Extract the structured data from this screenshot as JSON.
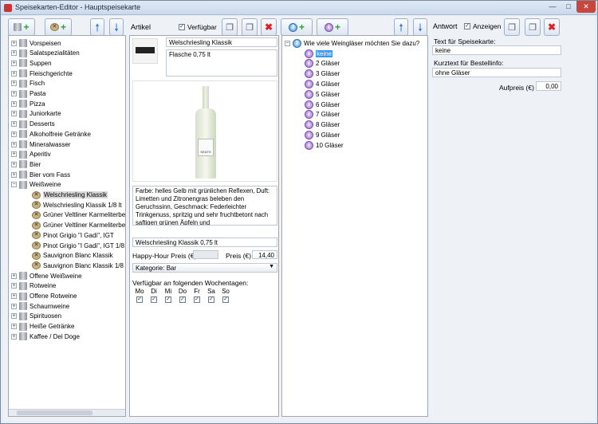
{
  "window": {
    "title": "Speisekarten-Editor - Hauptspeisekarte"
  },
  "toolbar": {
    "artikel_label": "Artikel",
    "verfuegbar_label": "Verfügbar",
    "antwort_label": "Antwort",
    "anzeigen_label": "Anzeigen"
  },
  "tree": {
    "categories_top": [
      "Vorspeisen",
      "Salatspezialitäten",
      "Suppen",
      "Fleischgerichte",
      "Fisch",
      "Pasta",
      "Pizza",
      "Juniorkarte",
      "Desserts",
      "Alkoholfreie Getränke",
      "Mineralwasser",
      "Aperitiv",
      "Bier",
      "Bier vom Fass",
      "Weißweine"
    ],
    "weissweine_items": [
      "Welschriesling Klassik",
      "Welschriesling Klassik 1/8 lt",
      "Grüner Veltliner Karmeliterber",
      "Grüner Veltliner Karmeliterber",
      "Pinot Grigio \"I Gadi\", IGT",
      "Pinot Grigio \"I Gadi\", IGT 1/8 lt",
      "Sauvignon Blanc Klassik",
      "Sauvignon Blanc Klassik 1/8 lt"
    ],
    "categories_bottom": [
      "Offene Weißweine",
      "Rotweine",
      "Offene Rotweine",
      "Schaumweine",
      "Spirituosen",
      "Heiße Getränke",
      "Kaffee / Del Doge"
    ]
  },
  "article": {
    "name": "Welschriesling Klassik",
    "subtitle": "Flasche 0,75 lt",
    "bottle_label": "KEATH",
    "description": "Farbe: helles Gelb mit grünlichen Reflexen, Duft: Limetten und Zitronengras beleben den Geruchssinn, Geschmack: Federleichter Trinkgenuss, spritzig und sehr fruchtbetont nach saftigen grünen Äpfeln und",
    "short_name": "Welschriesling Klassik 0,75 lt",
    "happy_hour_label": "Happy-Hour Preis (€)",
    "happy_hour_value": "",
    "price_label": "Preis (€)",
    "price_value": "14,40",
    "category_value": "Kategorie: Bar",
    "days_label": "Verfügbar an folgenden Wochentagen:",
    "days": [
      "Mo",
      "Di",
      "Mi",
      "Do",
      "Fr",
      "Sa",
      "So"
    ]
  },
  "question": {
    "text": "Wie viele Weingläser möchten Sie dazu?",
    "answers": [
      "keine",
      "2 Gläser",
      "3 Gläser",
      "4 Gläser",
      "5 Gläser",
      "6 Gläser",
      "7 Gläser",
      "8 Gläser",
      "9 Gläser",
      "10 Gläser"
    ]
  },
  "answer": {
    "menu_text_label": "Text für Speisekarte:",
    "menu_text_value": "keine",
    "short_text_label": "Kurztext für Bestellinfo:",
    "short_text_value": "ohne Gläser",
    "surcharge_label": "Aufpreis (€)",
    "surcharge_value": "0,00"
  },
  "icons": [
    "category-icon",
    "article-icon",
    "info-icon",
    "question-icon",
    "plus-icon",
    "arrow-up-icon",
    "arrow-down-icon",
    "copy-icon",
    "delete-icon"
  ]
}
